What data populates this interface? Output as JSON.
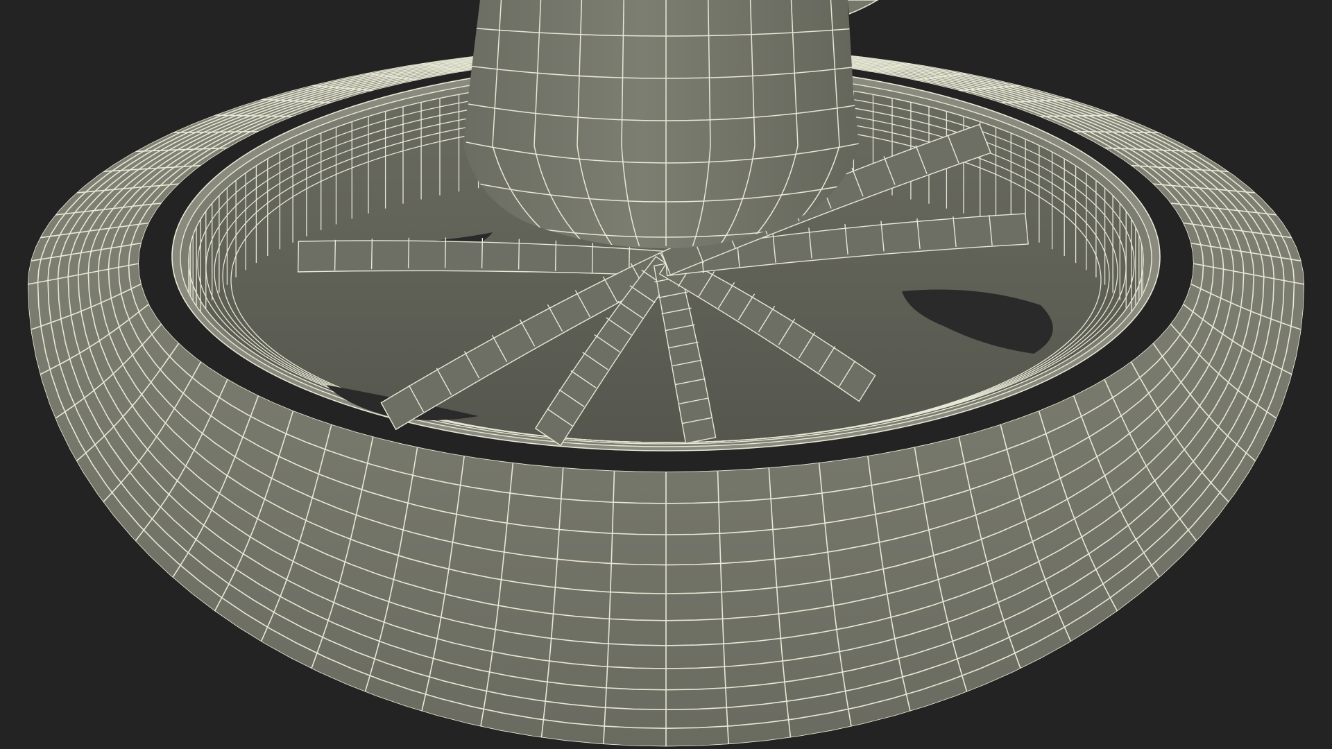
{
  "scene": {
    "subject": "wireframe-wheel",
    "colors": {
      "background": "#232323",
      "surface": "#76776b",
      "surface_light": "#828376",
      "surface_dark": "#5f6056",
      "shadow": "#4a4b43",
      "hole": "#2b2b2b",
      "wire": "#e8e8d6"
    }
  }
}
